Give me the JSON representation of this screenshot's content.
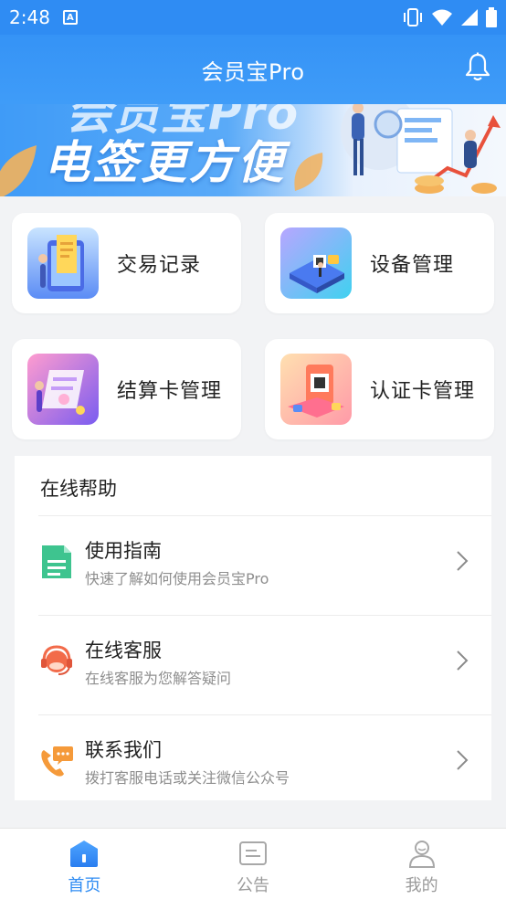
{
  "status_bar": {
    "time": "2:48",
    "notification_letter": "A"
  },
  "header": {
    "title": "会员宝Pro"
  },
  "banner": {
    "line1": "会员宝Pro",
    "line2": "电签更方便"
  },
  "cards": [
    {
      "label": "交易记录",
      "icon": "transaction-record-icon"
    },
    {
      "label": "设备管理",
      "icon": "device-management-icon"
    },
    {
      "label": "结算卡管理",
      "icon": "settlement-card-icon"
    },
    {
      "label": "认证卡管理",
      "icon": "certified-card-icon"
    }
  ],
  "help": {
    "title": "在线帮助",
    "items": [
      {
        "title": "使用指南",
        "subtitle": "快速了解如何使用会员宝Pro",
        "icon": "guide-document-icon"
      },
      {
        "title": "在线客服",
        "subtitle": "在线客服为您解答疑问",
        "icon": "customer-service-icon"
      },
      {
        "title": "联系我们",
        "subtitle": "拨打客服电话或关注微信公众号",
        "icon": "phone-chat-icon"
      }
    ]
  },
  "bottom_nav": {
    "items": [
      {
        "label": "首页",
        "active": true,
        "icon": "home-icon"
      },
      {
        "label": "公告",
        "active": false,
        "icon": "announcement-icon"
      },
      {
        "label": "我的",
        "active": false,
        "icon": "profile-icon"
      }
    ]
  },
  "colors": {
    "primary": "#2f8cf3",
    "background": "#f2f3f5",
    "text": "#222222",
    "subtext": "#8e8e8e"
  }
}
